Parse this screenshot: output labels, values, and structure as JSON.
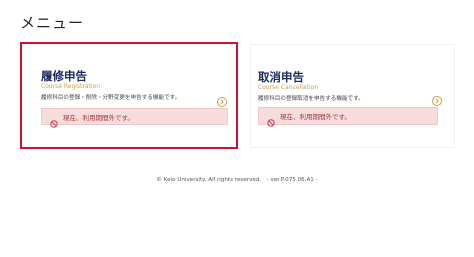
{
  "page": {
    "title": "メニュー"
  },
  "cards": [
    {
      "title": "履修申告",
      "subtitle": "Course Registration",
      "description": "履修科目の登録・削除・分野変更を申告する機能です。",
      "alert": "現在、利用期間外です。",
      "arrow_icon": "chevron-right-circle-icon",
      "highlighted": true
    },
    {
      "title": "取消申告",
      "subtitle": "Course Cancellation",
      "description": "履修科目の登録取消を申告する機能です。",
      "alert": "現在、利用期間外です。",
      "arrow_icon": "chevron-right-circle-icon",
      "highlighted": false
    }
  ],
  "footer": {
    "text": "© Keio University. All rights reserved.　- ver.P.075.06.A1 -"
  },
  "colors": {
    "title_navy": "#1c2c63",
    "subtitle_gold": "#c9a14e",
    "alert_bg": "#f7dcde",
    "alert_text": "#a33a3f",
    "highlight_border": "#d0112b"
  }
}
